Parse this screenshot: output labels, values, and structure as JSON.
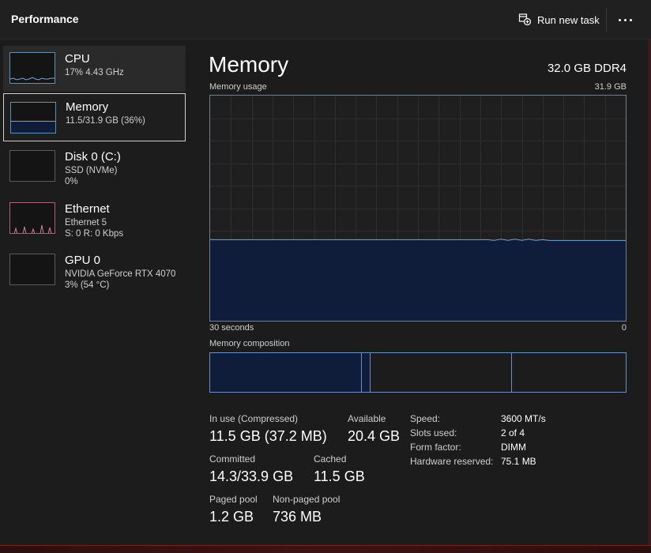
{
  "header": {
    "title": "Performance",
    "run_task_label": "Run new task"
  },
  "sidebar": {
    "items": [
      {
        "name": "CPU",
        "line1": "17%  4.43 GHz",
        "line2": ""
      },
      {
        "name": "Memory",
        "line1": "11.5/31.9 GB (36%)",
        "line2": ""
      },
      {
        "name": "Disk 0 (C:)",
        "line1": "SSD (NVMe)",
        "line2": "0%"
      },
      {
        "name": "Ethernet",
        "line1": "Ethernet 5",
        "line2": "S: 0 R: 0 Kbps"
      },
      {
        "name": "GPU 0",
        "line1": "NVIDIA GeForce RTX 4070",
        "line2": "3%  (54 °C)"
      }
    ]
  },
  "main": {
    "title": "Memory",
    "memory_type": "32.0 GB DDR4",
    "usage_label": "Memory usage",
    "usage_max": "31.9 GB",
    "time_left": "30 seconds",
    "time_right": "0",
    "usage_fraction": 0.36,
    "composition_label": "Memory composition",
    "stats": {
      "in_use_label": "In use (Compressed)",
      "in_use_value": "11.5 GB (37.2 MB)",
      "available_label": "Available",
      "available_value": "20.4 GB",
      "committed_label": "Committed",
      "committed_value": "14.3/33.9 GB",
      "cached_label": "Cached",
      "cached_value": "11.5 GB",
      "paged_label": "Paged pool",
      "paged_value": "1.2 GB",
      "nonpaged_label": "Non-paged pool",
      "nonpaged_value": "736 MB"
    },
    "details": [
      {
        "label": "Speed:",
        "value": "3600 MT/s"
      },
      {
        "label": "Slots used:",
        "value": "2 of 4"
      },
      {
        "label": "Form factor:",
        "value": "DIMM"
      },
      {
        "label": "Hardware reserved:",
        "value": "75.1 MB"
      }
    ]
  },
  "colors": {
    "accent": "#6fa8dc",
    "graph_fill": "#0f1d3a",
    "ethernet": "#d97b9a"
  }
}
